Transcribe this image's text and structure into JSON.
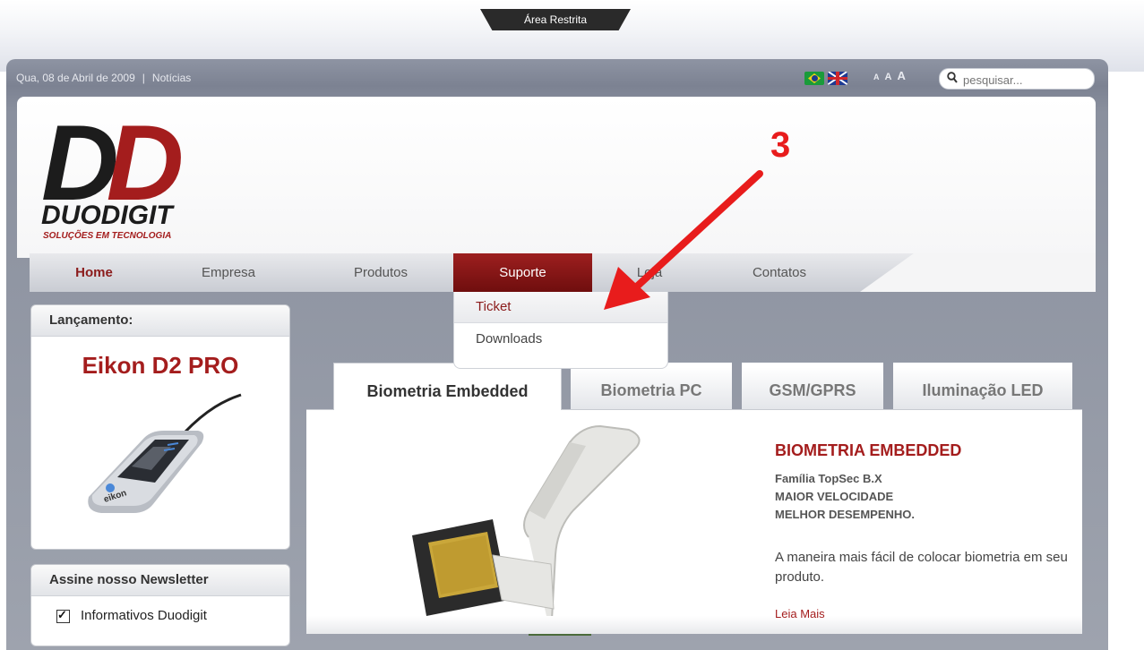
{
  "top_tab": {
    "label": "Área Restrita"
  },
  "topbar": {
    "date": "Qua, 08 de Abril de 2009",
    "separator": "|",
    "news_link": "Notícias",
    "font_sizes": [
      "A",
      "A",
      "A"
    ],
    "search_placeholder": "pesquisar..."
  },
  "logo": {
    "letters": [
      "D",
      "D"
    ],
    "name": "DUODIGIT",
    "tagline": "SOLUÇÕES EM TECNOLOGIA"
  },
  "annotation": {
    "number": "3",
    "color": "#e81c1c"
  },
  "nav": {
    "items": [
      {
        "label": "Home"
      },
      {
        "label": "Empresa"
      },
      {
        "label": "Produtos"
      },
      {
        "label": "Suporte"
      },
      {
        "label": "Loja"
      },
      {
        "label": "Contatos"
      }
    ],
    "dropdown": [
      {
        "label": "Ticket"
      },
      {
        "label": "Downloads"
      }
    ]
  },
  "sidebar": {
    "launch": {
      "heading": "Lançamento:",
      "product": "Eikon D2 PRO",
      "device_label": "eikon"
    },
    "newsletter": {
      "heading": "Assine nosso Newsletter",
      "option": "Informativos Duodigit"
    }
  },
  "tabs": [
    {
      "label": "Biometria Embedded"
    },
    {
      "label": "Biometria PC"
    },
    {
      "label": "GSM/GPRS"
    },
    {
      "label": "Iluminação LED"
    }
  ],
  "product": {
    "title": "BIOMETRIA EMBEDDED",
    "lines": [
      "Família TopSec B.X",
      "MAIOR VELOCIDADE",
      "MELHOR DESEMPENHO."
    ],
    "description": "A maneira mais fácil de colocar biometria em seu produto.",
    "more": "Leia Mais"
  },
  "colors": {
    "brand_red": "#a41d1d",
    "nav_active": "#8b1c1c",
    "frame_gray": "#7c8292"
  }
}
